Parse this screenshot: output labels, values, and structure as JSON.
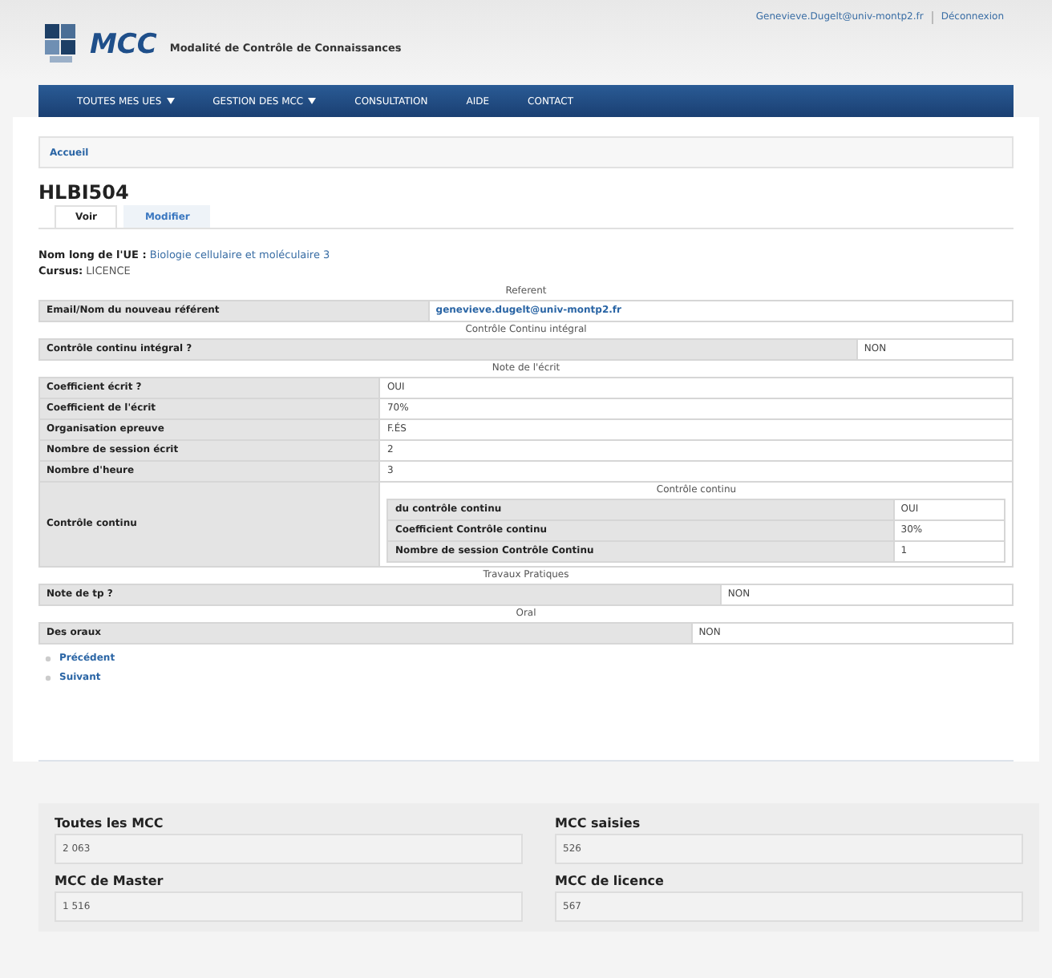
{
  "header": {
    "logo_text": "MCC",
    "subtitle": "Modalité de Contrôle de Connaissances",
    "user_email": "Genevieve.Dugelt@univ-montp2.fr",
    "logout": "Déconnexion"
  },
  "nav": [
    {
      "label": "TOUTES MES UES",
      "has_menu": true
    },
    {
      "label": "GESTION DES MCC",
      "has_menu": true
    },
    {
      "label": "CONSULTATION",
      "has_menu": false
    },
    {
      "label": "AIDE",
      "has_menu": false
    },
    {
      "label": "CONTACT",
      "has_menu": false
    }
  ],
  "breadcrumb": [
    "Accueil"
  ],
  "page_title": "HLBI504",
  "tabs": [
    {
      "label": "Voir",
      "selected": true
    },
    {
      "label": "Modifier",
      "selected": false
    }
  ],
  "info": [
    {
      "label": "Nom long de l'UE :",
      "value": "Biologie cellulaire et moléculaire 3",
      "kind": "link"
    },
    {
      "label": "Cursus:",
      "value": "LICENCE",
      "kind": "text"
    }
  ],
  "sections": [
    {
      "title": "Referent",
      "rows": [
        {
          "kind": "link",
          "label": "Email/Nom du nouveau référent",
          "value": "genevieve.dugelt@univ-montp2.fr"
        }
      ]
    },
    {
      "title": "Contrôle Continu intégral",
      "rows": [
        {
          "kind": "text",
          "label": "Contrôle continu intégral ?",
          "value": "NON"
        }
      ]
    },
    {
      "title": "Note de l'écrit",
      "rows": [
        {
          "kind": "text",
          "label": "Coefficient écrit ?",
          "value": "OUI"
        },
        {
          "kind": "text",
          "label": "Coefficient de l'écrit",
          "value": "70%"
        },
        {
          "kind": "text",
          "label": "Organisation epreuve",
          "value": "F.ÉS"
        },
        {
          "kind": "text",
          "label": "Nombre de session écrit",
          "value": "2"
        },
        {
          "kind": "text",
          "label": "Nombre d'heure",
          "value": "3"
        },
        {
          "kind": "nested",
          "label": "Contrôle continu",
          "title": "Contrôle continu",
          "rows": [
            {
              "label": "du contrôle continu",
              "value": "OUI"
            },
            {
              "label": "Coefficient Contrôle continu",
              "value": "30%"
            },
            {
              "label": "Nombre de session Contrôle Continu",
              "value": "1"
            }
          ]
        }
      ]
    },
    {
      "title": "Travaux Pratiques",
      "rows": [
        {
          "kind": "text",
          "label": "Note de tp ?",
          "value": "NON"
        }
      ]
    },
    {
      "title": "Oral",
      "rows": [
        {
          "kind": "text",
          "label": "Des oraux",
          "value": "NON"
        }
      ]
    }
  ],
  "pager": [
    "Précédent",
    "Suivant"
  ],
  "stats": [
    {
      "label": "Toutes les MCC",
      "value": "2 063"
    },
    {
      "label": "MCC saisies",
      "value": "526"
    },
    {
      "label": "MCC de Master",
      "value": "1 516"
    },
    {
      "label": "MCC de licence",
      "value": "567"
    }
  ]
}
